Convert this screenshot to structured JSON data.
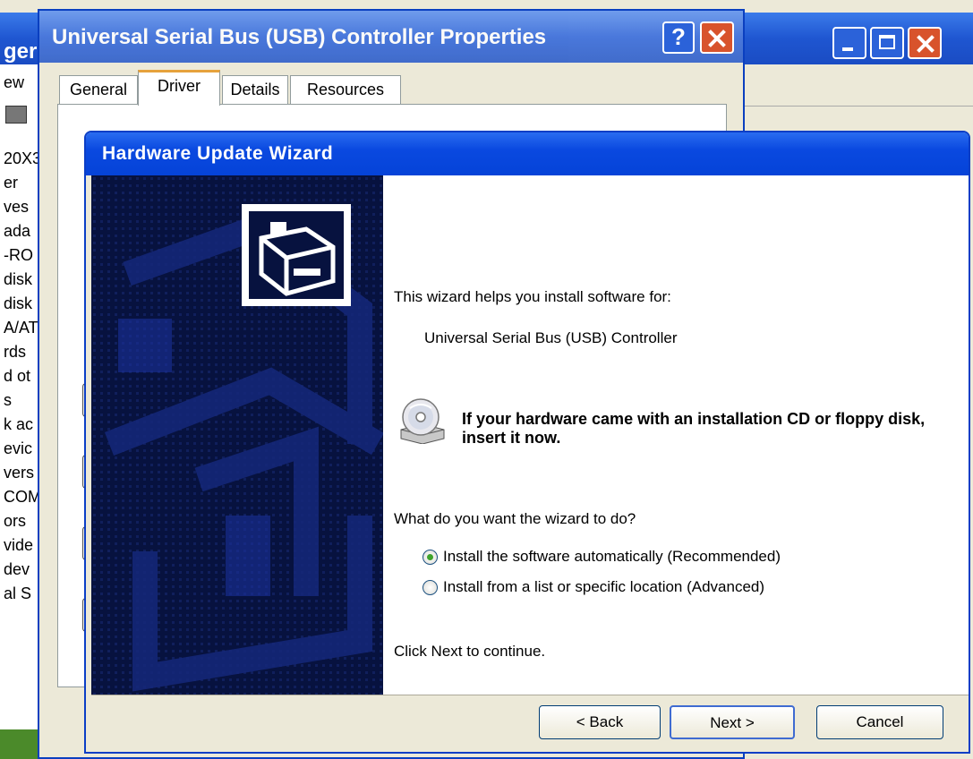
{
  "device_manager": {
    "title_fragment": "ger",
    "menu_fragment": "ew",
    "tree_fragments": [
      "20X3",
      "er",
      "ves",
      "ada",
      "-RO",
      "disk",
      "disk",
      "A/AT",
      "rds",
      "d ot",
      "s",
      "k ac",
      "evic",
      "vers",
      "COM",
      "ors",
      "vide",
      "dev",
      "al S"
    ]
  },
  "properties_window": {
    "title": "Universal Serial Bus (USB) Controller Properties",
    "help_label": "?",
    "tabs": [
      {
        "label": "General"
      },
      {
        "label": "Driver"
      },
      {
        "label": "Details"
      },
      {
        "label": "Resources"
      }
    ]
  },
  "wizard": {
    "title": "Hardware Update Wizard",
    "intro": "This wizard helps you install software for:",
    "device_name": "Universal Serial Bus (USB) Controller",
    "cd_prompt": "If your hardware came with an installation CD or floppy disk, insert it now.",
    "question": "What do you want the wizard to do?",
    "options": [
      {
        "label": "Install the software automatically (Recommended)",
        "selected": true
      },
      {
        "label": "Install from a list or specific location (Advanced)",
        "selected": false
      }
    ],
    "continue_text": "Click Next to continue.",
    "buttons": {
      "back": "< Back",
      "next": "Next >",
      "cancel": "Cancel"
    }
  },
  "colors": {
    "title_bar_blue": "#0a49e0",
    "wizard_side_panel": "#07123f",
    "window_face": "#ece9d8",
    "radio_selected": "#3fa32b"
  },
  "icons": [
    "help-icon",
    "close-icon",
    "minimize-icon",
    "maximize-icon",
    "hardware-icon",
    "cd-drive-icon"
  ]
}
